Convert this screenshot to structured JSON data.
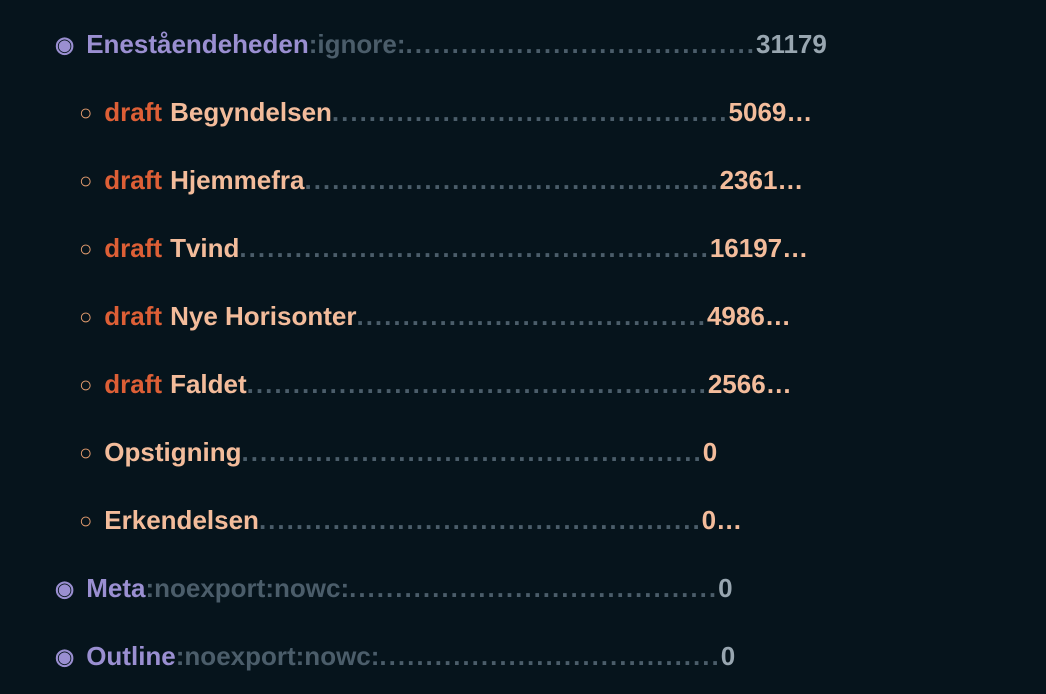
{
  "rows": [
    {
      "level": "top",
      "bullet": "◉",
      "todo": "",
      "title": "Eneståendeheden",
      "tags": " :ignore:",
      "dots": "......................................",
      "count": "31179",
      "trailing": ""
    },
    {
      "level": "sub",
      "bullet": "○",
      "todo": "draft",
      "title": "Begyndelsen",
      "tags": "",
      "dots": "...........................................",
      "count": "5069",
      "trailing": "…"
    },
    {
      "level": "sub",
      "bullet": "○",
      "todo": "draft",
      "title": "Hjemmefra",
      "tags": "",
      "dots": ".............................................",
      "count": "2361",
      "trailing": "…"
    },
    {
      "level": "sub",
      "bullet": "○",
      "todo": "draft",
      "title": "Tvind",
      "tags": "",
      "dots": "...................................................",
      "count": "16197",
      "trailing": "…"
    },
    {
      "level": "sub",
      "bullet": "○",
      "todo": "draft",
      "title": "Nye Horisonter",
      "tags": "",
      "dots": "......................................",
      "count": "4986",
      "trailing": "…"
    },
    {
      "level": "sub",
      "bullet": "○",
      "todo": "draft",
      "title": "Faldet",
      "tags": "",
      "dots": "..................................................",
      "count": "2566",
      "trailing": "…"
    },
    {
      "level": "sub",
      "bullet": "○",
      "todo": "",
      "title": "Opstigning",
      "tags": "",
      "dots": "..................................................",
      "count": "0",
      "trailing": ""
    },
    {
      "level": "sub",
      "bullet": "○",
      "todo": "",
      "title": "Erkendelsen",
      "tags": "",
      "dots": "................................................",
      "count": "0",
      "trailing": "…"
    },
    {
      "level": "top",
      "bullet": "◉",
      "todo": "",
      "title": "Meta",
      "tags": " :noexport:nowc:",
      "dots": "........................................",
      "count": "0",
      "trailing": ""
    },
    {
      "level": "top",
      "bullet": "◉",
      "todo": "",
      "title": "Outline",
      "tags": " :noexport:nowc:",
      "dots": ".....................................",
      "count": "0",
      "trailing": ""
    }
  ]
}
